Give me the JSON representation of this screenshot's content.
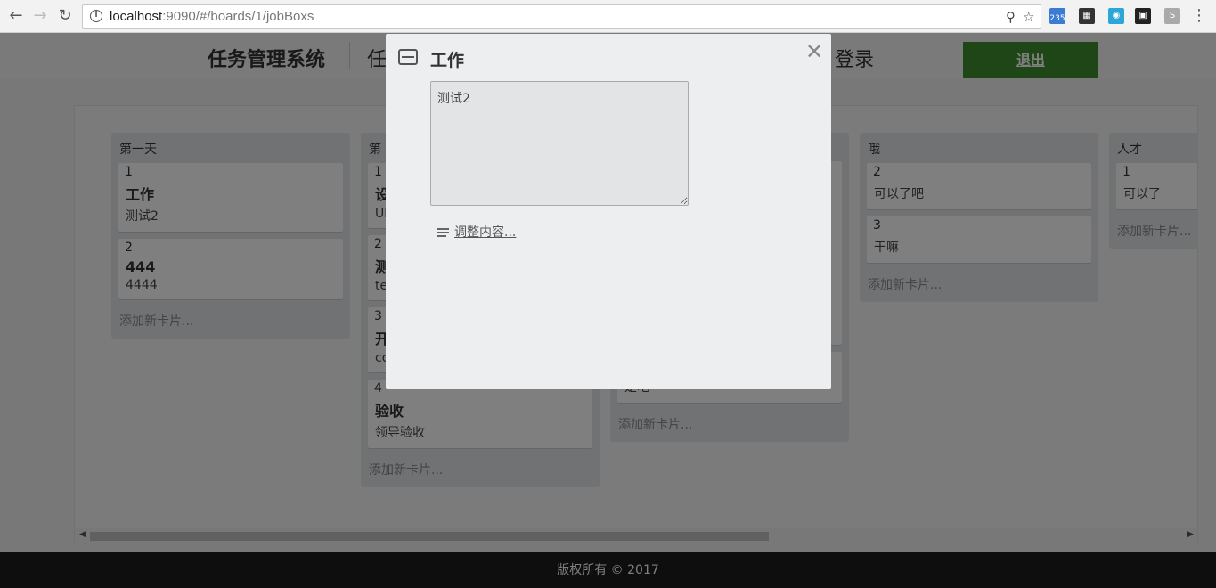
{
  "browser": {
    "url_host": "localhost",
    "url_rest": ":9090/#/boards/1/jobBoxs",
    "ext_badge": "235"
  },
  "header": {
    "brand": "任务管理系统",
    "nav_partial": "任",
    "login": "登录",
    "logout": "退出"
  },
  "columns": [
    {
      "title": "第一天",
      "cards": [
        {
          "num": "1",
          "title": "工作",
          "desc": "测试2"
        },
        {
          "num": "2",
          "title": "444",
          "desc": "4444"
        }
      ],
      "add": "添加新卡片..."
    },
    {
      "title": "第",
      "cards": [
        {
          "num": "1",
          "title": "设",
          "desc": "UI"
        },
        {
          "num": "2",
          "title": "测",
          "desc": "te"
        },
        {
          "num": "3",
          "title": "开",
          "desc": "co"
        },
        {
          "num": "4",
          "title": "验收",
          "desc": "领导验收"
        }
      ],
      "add": "添加新卡片..."
    },
    {
      "title": "",
      "cards": [
        {
          "num": "",
          "title": "",
          "desc": "是吧"
        }
      ],
      "add": "添加新卡片..."
    },
    {
      "title": "哦",
      "cards": [
        {
          "num": "2",
          "title": "",
          "desc": "可以了吧"
        },
        {
          "num": "3",
          "title": "",
          "desc": "干嘛"
        }
      ],
      "add": "添加新卡片..."
    },
    {
      "title": "人才",
      "cards": [
        {
          "num": "1",
          "title": "",
          "desc": "可以了"
        }
      ],
      "add": "添加新卡片..."
    }
  ],
  "footer": "版权所有 © 2017",
  "modal": {
    "title": "工作",
    "description": "测试2",
    "edit_link": "调整内容..."
  }
}
